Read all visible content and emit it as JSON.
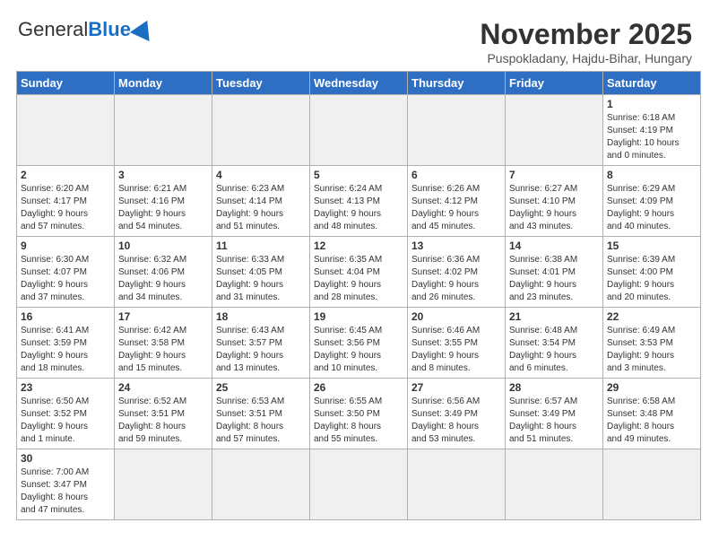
{
  "header": {
    "logo_general": "General",
    "logo_blue": "Blue",
    "month_title": "November 2025",
    "location": "Puspokladany, Hajdu-Bihar, Hungary"
  },
  "weekdays": [
    "Sunday",
    "Monday",
    "Tuesday",
    "Wednesday",
    "Thursday",
    "Friday",
    "Saturday"
  ],
  "weeks": [
    [
      {
        "day": "",
        "info": ""
      },
      {
        "day": "",
        "info": ""
      },
      {
        "day": "",
        "info": ""
      },
      {
        "day": "",
        "info": ""
      },
      {
        "day": "",
        "info": ""
      },
      {
        "day": "",
        "info": ""
      },
      {
        "day": "1",
        "info": "Sunrise: 6:18 AM\nSunset: 4:19 PM\nDaylight: 10 hours\nand 0 minutes."
      }
    ],
    [
      {
        "day": "2",
        "info": "Sunrise: 6:20 AM\nSunset: 4:17 PM\nDaylight: 9 hours\nand 57 minutes."
      },
      {
        "day": "3",
        "info": "Sunrise: 6:21 AM\nSunset: 4:16 PM\nDaylight: 9 hours\nand 54 minutes."
      },
      {
        "day": "4",
        "info": "Sunrise: 6:23 AM\nSunset: 4:14 PM\nDaylight: 9 hours\nand 51 minutes."
      },
      {
        "day": "5",
        "info": "Sunrise: 6:24 AM\nSunset: 4:13 PM\nDaylight: 9 hours\nand 48 minutes."
      },
      {
        "day": "6",
        "info": "Sunrise: 6:26 AM\nSunset: 4:12 PM\nDaylight: 9 hours\nand 45 minutes."
      },
      {
        "day": "7",
        "info": "Sunrise: 6:27 AM\nSunset: 4:10 PM\nDaylight: 9 hours\nand 43 minutes."
      },
      {
        "day": "8",
        "info": "Sunrise: 6:29 AM\nSunset: 4:09 PM\nDaylight: 9 hours\nand 40 minutes."
      }
    ],
    [
      {
        "day": "9",
        "info": "Sunrise: 6:30 AM\nSunset: 4:07 PM\nDaylight: 9 hours\nand 37 minutes."
      },
      {
        "day": "10",
        "info": "Sunrise: 6:32 AM\nSunset: 4:06 PM\nDaylight: 9 hours\nand 34 minutes."
      },
      {
        "day": "11",
        "info": "Sunrise: 6:33 AM\nSunset: 4:05 PM\nDaylight: 9 hours\nand 31 minutes."
      },
      {
        "day": "12",
        "info": "Sunrise: 6:35 AM\nSunset: 4:04 PM\nDaylight: 9 hours\nand 28 minutes."
      },
      {
        "day": "13",
        "info": "Sunrise: 6:36 AM\nSunset: 4:02 PM\nDaylight: 9 hours\nand 26 minutes."
      },
      {
        "day": "14",
        "info": "Sunrise: 6:38 AM\nSunset: 4:01 PM\nDaylight: 9 hours\nand 23 minutes."
      },
      {
        "day": "15",
        "info": "Sunrise: 6:39 AM\nSunset: 4:00 PM\nDaylight: 9 hours\nand 20 minutes."
      }
    ],
    [
      {
        "day": "16",
        "info": "Sunrise: 6:41 AM\nSunset: 3:59 PM\nDaylight: 9 hours\nand 18 minutes."
      },
      {
        "day": "17",
        "info": "Sunrise: 6:42 AM\nSunset: 3:58 PM\nDaylight: 9 hours\nand 15 minutes."
      },
      {
        "day": "18",
        "info": "Sunrise: 6:43 AM\nSunset: 3:57 PM\nDaylight: 9 hours\nand 13 minutes."
      },
      {
        "day": "19",
        "info": "Sunrise: 6:45 AM\nSunset: 3:56 PM\nDaylight: 9 hours\nand 10 minutes."
      },
      {
        "day": "20",
        "info": "Sunrise: 6:46 AM\nSunset: 3:55 PM\nDaylight: 9 hours\nand 8 minutes."
      },
      {
        "day": "21",
        "info": "Sunrise: 6:48 AM\nSunset: 3:54 PM\nDaylight: 9 hours\nand 6 minutes."
      },
      {
        "day": "22",
        "info": "Sunrise: 6:49 AM\nSunset: 3:53 PM\nDaylight: 9 hours\nand 3 minutes."
      }
    ],
    [
      {
        "day": "23",
        "info": "Sunrise: 6:50 AM\nSunset: 3:52 PM\nDaylight: 9 hours\nand 1 minute."
      },
      {
        "day": "24",
        "info": "Sunrise: 6:52 AM\nSunset: 3:51 PM\nDaylight: 8 hours\nand 59 minutes."
      },
      {
        "day": "25",
        "info": "Sunrise: 6:53 AM\nSunset: 3:51 PM\nDaylight: 8 hours\nand 57 minutes."
      },
      {
        "day": "26",
        "info": "Sunrise: 6:55 AM\nSunset: 3:50 PM\nDaylight: 8 hours\nand 55 minutes."
      },
      {
        "day": "27",
        "info": "Sunrise: 6:56 AM\nSunset: 3:49 PM\nDaylight: 8 hours\nand 53 minutes."
      },
      {
        "day": "28",
        "info": "Sunrise: 6:57 AM\nSunset: 3:49 PM\nDaylight: 8 hours\nand 51 minutes."
      },
      {
        "day": "29",
        "info": "Sunrise: 6:58 AM\nSunset: 3:48 PM\nDaylight: 8 hours\nand 49 minutes."
      }
    ],
    [
      {
        "day": "30",
        "info": "Sunrise: 7:00 AM\nSunset: 3:47 PM\nDaylight: 8 hours\nand 47 minutes."
      },
      {
        "day": "",
        "info": ""
      },
      {
        "day": "",
        "info": ""
      },
      {
        "day": "",
        "info": ""
      },
      {
        "day": "",
        "info": ""
      },
      {
        "day": "",
        "info": ""
      },
      {
        "day": "",
        "info": ""
      }
    ]
  ]
}
